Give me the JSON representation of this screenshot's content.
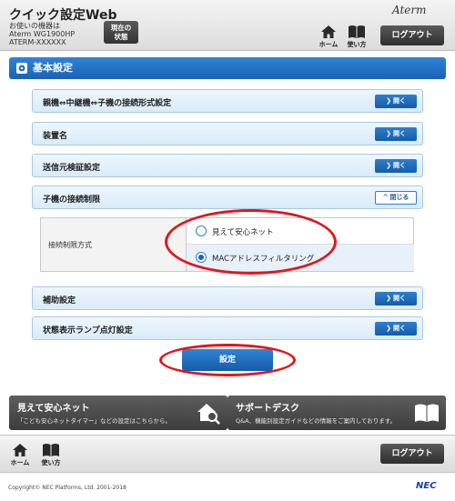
{
  "header": {
    "title": "クイック設定Web",
    "device_caption": "お使いの機器は",
    "device_model": "Aterm WG1900HP",
    "device_sub": "ATERM-XXXXXX",
    "status_button": "現在の\n状態",
    "status_line1": "現在の",
    "status_line2": "状態",
    "logo": "Aterm",
    "home_label": "ホーム",
    "manual_label": "使い方",
    "logout_label": "ログアウト"
  },
  "section": {
    "title": "基本設定",
    "icon": "gear-icon"
  },
  "accordions": [
    {
      "label": "親機⇔中継機⇔子機の接続形式設定",
      "button": "開く"
    },
    {
      "label": "装置名",
      "button": "開く"
    },
    {
      "label": "送信元検証設定",
      "button": "開く"
    },
    {
      "label": "子機の接続制限",
      "button": "閉じる"
    },
    {
      "label": "補助設定",
      "button": "開く"
    },
    {
      "label": "状態表示ランプ点灯設定",
      "button": "開く"
    }
  ],
  "restriction": {
    "field_label": "接続制限方式",
    "options": [
      {
        "label": "見えて安心ネット",
        "selected": false
      },
      {
        "label": "MACアドレスフィルタリング",
        "selected": true
      }
    ]
  },
  "set_button": "設定",
  "tiles": [
    {
      "title": "見えて安心ネット",
      "subtitle": "「こども安心ネットタイマー」などの設定はこちらから。",
      "icon": "house-search-icon"
    },
    {
      "title": "サポートデスク",
      "subtitle": "Q&A、機能別設定ガイドなどの情報をご案内しております。",
      "icon": "book-icon"
    }
  ],
  "footer": {
    "home_label": "ホーム",
    "manual_label": "使い方",
    "logout_label": "ログアウト",
    "copyright": "Copyright© NEC Platforms, Ltd. 2001-2018",
    "brand": "NEC"
  },
  "colors": {
    "accent_blue": "#1b62b3",
    "annotation_red": "#e3151b",
    "dark_button": "#3c3c3c"
  }
}
